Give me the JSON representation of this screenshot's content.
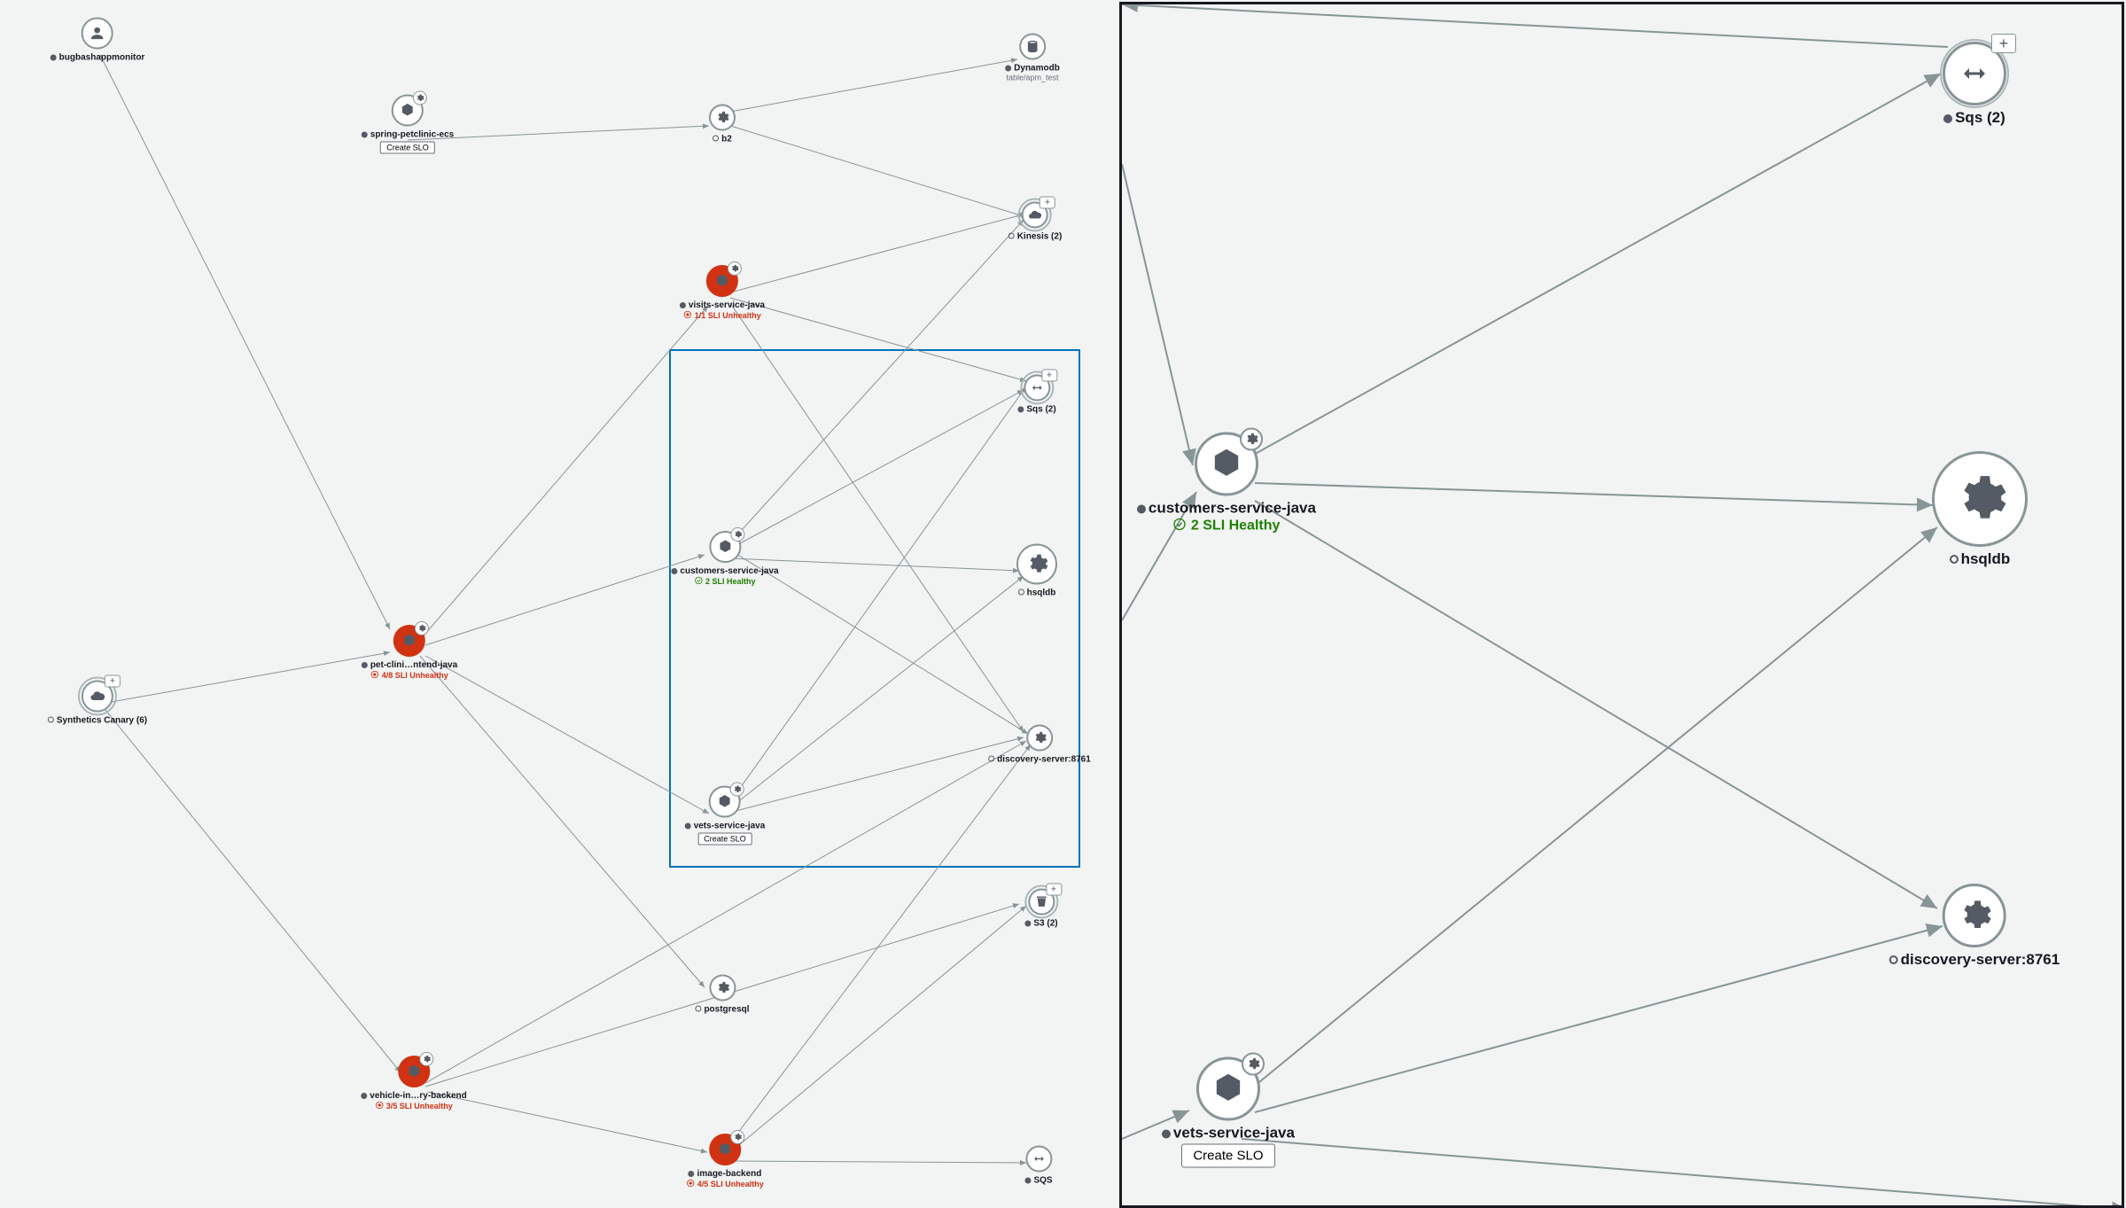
{
  "left": {
    "nodes": {
      "bugbash": {
        "label": "bugbashappmonitor"
      },
      "spring": {
        "label": "spring-petclinic-ecs",
        "slo_btn": "Create SLO"
      },
      "b2": {
        "label": "b2"
      },
      "dynamo": {
        "label": "Dynamodb",
        "sub": "table/apm_test"
      },
      "kinesis": {
        "label": "Kinesis (2)"
      },
      "visits": {
        "label": "visits-service-java",
        "status": "1/1 SLI Unhealthy"
      },
      "sqs": {
        "label": "Sqs (2)"
      },
      "customers": {
        "label": "customers-service-java",
        "status": "2 SLI Healthy"
      },
      "hsqldb": {
        "label": "hsqldb"
      },
      "petclinic": {
        "label": "pet-clini…ntend-java",
        "status": "4/8 SLI Unhealthy"
      },
      "canary": {
        "label": "Synthetics Canary (6)"
      },
      "discovery": {
        "label": "discovery-server:8761"
      },
      "vets": {
        "label": "vets-service-java",
        "slo_btn": "Create SLO"
      },
      "s3": {
        "label": "S3 (2)"
      },
      "postgresql": {
        "label": "postgresql"
      },
      "vehicle": {
        "label": "vehicle-in…ry-backend",
        "status": "3/5 SLI Unhealthy"
      },
      "image": {
        "label": "image-backend",
        "status": "4/5 SLI Unhealthy"
      },
      "sqs2": {
        "label": "SQS"
      }
    }
  },
  "right": {
    "nodes": {
      "sqs": {
        "label": "Sqs (2)"
      },
      "customers": {
        "label": "customers-service-java",
        "status": "2 SLI Healthy"
      },
      "hsqldb": {
        "label": "hsqldb"
      },
      "discovery": {
        "label": "discovery-server:8761"
      },
      "vets": {
        "label": "vets-service-java",
        "slo_btn": "Create SLO"
      }
    }
  },
  "plus_label": "+"
}
